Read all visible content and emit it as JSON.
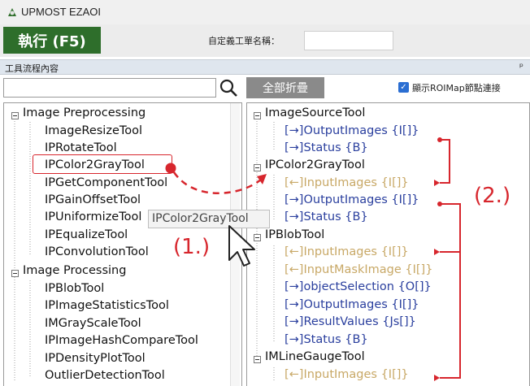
{
  "window": {
    "title": "UPMOST EZAOI"
  },
  "toolbar": {
    "run_label": "執行 (F5)",
    "form_name_label": "自定義工單名稱：",
    "form_name_value": ""
  },
  "section": {
    "title": "工具流程內容",
    "pin_icon": "pin-icon"
  },
  "left_panel": {
    "search_value": "",
    "search_icon": "search-icon",
    "categories": [
      {
        "label": "Image Preprocessing",
        "items": [
          "ImageResizeTool",
          "IPRotateTool",
          "IPColor2GrayTool",
          "IPGetComponentTool",
          "IPGainOffsetTool",
          "IPUniformizeTool",
          "IPEqualizeTool",
          "IPConvolutionTool"
        ]
      },
      {
        "label": "Image Processing",
        "items": [
          "IPBlobTool",
          "IPImageStatisticsTool",
          "IMGrayScaleTool",
          "IPImageHashCompareTool",
          "IPDensityPlotTool",
          "OutlierDetectionTool"
        ]
      }
    ]
  },
  "right_panel": {
    "collapse_all_label": "全部折疊",
    "show_roimap_label": "顯示ROIMap節點連接",
    "show_roimap_checked": true,
    "nodes": [
      {
        "name": "ImageSourceTool",
        "ports": [
          {
            "text": "[→]OutputImages {I[]}",
            "dir": "out"
          },
          {
            "text": "[→]Status {B}",
            "dir": "out"
          }
        ]
      },
      {
        "name": "IPColor2GrayTool",
        "ports": [
          {
            "text": "[←]InputImages {I[]}",
            "dir": "in"
          },
          {
            "text": "[→]OutputImages {I[]}",
            "dir": "out"
          },
          {
            "text": "[→]Status {B}",
            "dir": "out"
          }
        ]
      },
      {
        "name": "IPBlobTool",
        "ports": [
          {
            "text": "[←]InputImages {I[]}",
            "dir": "in"
          },
          {
            "text": "[←]InputMaskImage {I[]}",
            "dir": "in"
          },
          {
            "text": "[→]objectSelection {O[]}",
            "dir": "out"
          },
          {
            "text": "[→]OutputImages {I[]}",
            "dir": "out"
          },
          {
            "text": "[→]ResultValues {Js[]}",
            "dir": "out"
          },
          {
            "text": "[→]Status {B}",
            "dir": "out"
          }
        ]
      },
      {
        "name": "IMLineGaugeTool",
        "ports": [
          {
            "text": "[←]InputImages {I[]}",
            "dir": "in"
          }
        ]
      }
    ]
  },
  "annotations": {
    "drag_tooltip": "IPColor2GrayTool",
    "step1": "(1.)",
    "step2": "(2.)",
    "highlight_color": "#d7262d"
  }
}
